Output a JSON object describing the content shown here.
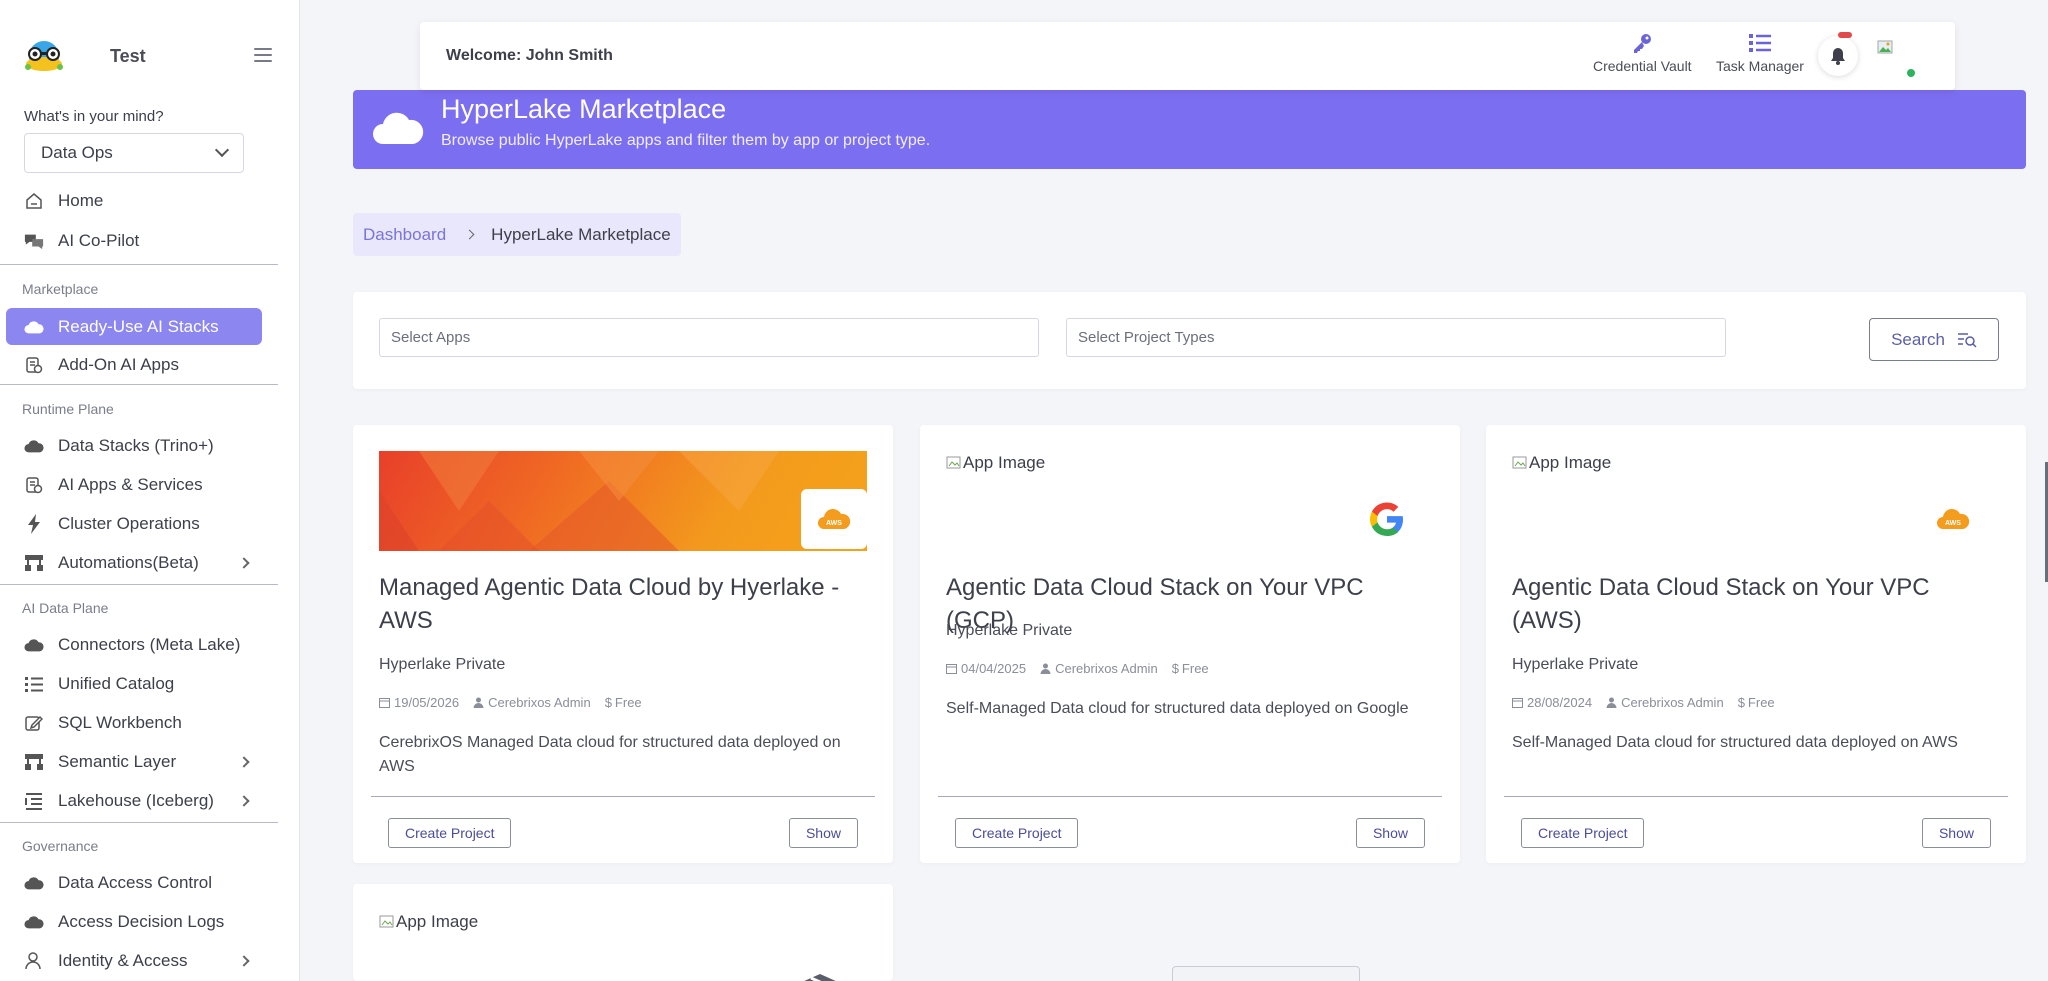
{
  "app": {
    "name": "Test"
  },
  "sidebar": {
    "mind_label": "What's in your mind?",
    "mind_value": "Data Ops",
    "top_items": [
      {
        "label": "Home",
        "icon": "home-icon"
      },
      {
        "label": "AI Co-Pilot",
        "icon": "chat-icon"
      }
    ],
    "sections": [
      {
        "label": "Marketplace",
        "items": [
          {
            "label": "Ready-Use AI Stacks",
            "icon": "cloud-icon",
            "active": true
          },
          {
            "label": "Add-On AI Apps",
            "icon": "apps-icon"
          }
        ]
      },
      {
        "label": "Runtime Plane",
        "items": [
          {
            "label": "Data Stacks (Trino+)",
            "icon": "cloud-icon"
          },
          {
            "label": "AI Apps & Services",
            "icon": "apps-icon"
          },
          {
            "label": "Cluster Operations",
            "icon": "bolt-icon"
          },
          {
            "label": "Automations(Beta)",
            "icon": "sitemap-icon",
            "has_children": true
          }
        ]
      },
      {
        "label": "AI Data Plane",
        "items": [
          {
            "label": "Connectors (Meta Lake)",
            "icon": "cloud-icon"
          },
          {
            "label": "Unified Catalog",
            "icon": "list-icon"
          },
          {
            "label": "SQL Workbench",
            "icon": "edit-icon"
          },
          {
            "label": "Semantic Layer",
            "icon": "sitemap-icon",
            "has_children": true
          },
          {
            "label": "Lakehouse (Iceberg)",
            "icon": "list-check-icon",
            "has_children": true
          }
        ]
      },
      {
        "label": "Governance",
        "items": [
          {
            "label": "Data Access Control",
            "icon": "cloud-icon"
          },
          {
            "label": "Access Decision Logs",
            "icon": "cloud-icon"
          },
          {
            "label": "Identity & Access",
            "icon": "user-icon",
            "has_children": true
          }
        ]
      }
    ]
  },
  "topbar": {
    "welcome": "Welcome: John Smith",
    "credential_vault": "Credential Vault",
    "task_manager": "Task Manager"
  },
  "banner": {
    "title": "HyperLake Marketplace",
    "subtitle": "Browse public HyperLake apps and filter them by app or project type."
  },
  "breadcrumb": {
    "root": "Dashboard",
    "current": "HyperLake Marketplace"
  },
  "filters": {
    "apps_placeholder": "Select Apps",
    "project_types_placeholder": "Select Project Types",
    "search_label": "Search"
  },
  "cards": [
    {
      "image_alt": "",
      "provider": "AWS",
      "title": "Managed Agentic Data Cloud by Hyerlake - AWS",
      "subtitle": "Hyperlake Private",
      "date": "19/05/2026",
      "author": "Cerebrixos Admin",
      "price": "Free",
      "description": "CerebrixOS Managed Data cloud for structured data deployed on AWS",
      "create_label": "Create Project",
      "show_label": "Show"
    },
    {
      "image_alt": "App Image",
      "provider": "Google",
      "title": "Agentic Data Cloud Stack on Your VPC (GCP)",
      "subtitle": "Hyperlake Private",
      "date": "04/04/2025",
      "author": "Cerebrixos Admin",
      "price": "Free",
      "description": "Self-Managed Data cloud for structured data deployed on Google",
      "create_label": "Create Project",
      "show_label": "Show"
    },
    {
      "image_alt": "App Image",
      "provider": "AWS",
      "title": "Agentic Data Cloud Stack on Your VPC (AWS)",
      "subtitle": "Hyperlake Private",
      "date": "28/08/2024",
      "author": "Cerebrixos Admin",
      "price": "Free",
      "description": "Self-Managed Data cloud for structured data deployed on AWS",
      "create_label": "Create Project",
      "show_label": "Show"
    },
    {
      "image_alt": "App Image",
      "provider": "box"
    }
  ],
  "colors": {
    "accent": "#7c6ef0",
    "active_nav": "#8c86f0",
    "link": "#7a74d8"
  }
}
